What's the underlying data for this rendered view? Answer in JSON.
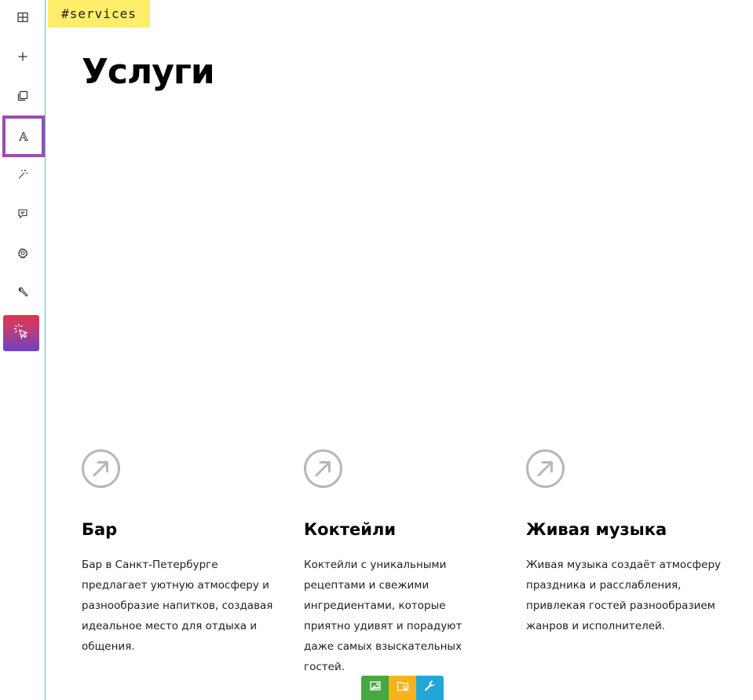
{
  "toolbar": {
    "items": [
      {
        "icon": "layout-grid-icon",
        "name": "blocks"
      },
      {
        "icon": "plus-icon",
        "name": "add"
      },
      {
        "icon": "copy-icon",
        "name": "duplicate"
      },
      {
        "icon": "font-icon",
        "name": "typography",
        "glyph": "𝔸",
        "active": true
      },
      {
        "icon": "magic-wand-icon",
        "name": "effects"
      },
      {
        "icon": "comment-icon",
        "name": "comments"
      },
      {
        "icon": "gear-icon",
        "name": "settings"
      },
      {
        "icon": "wrench-icon",
        "name": "tools"
      },
      {
        "icon": "cursor-click-icon",
        "name": "interactive"
      }
    ],
    "accent_color": "#9b4bb5",
    "border_color": "#33d1bc"
  },
  "anchor_tag": "#services",
  "section": {
    "title": "Услуги"
  },
  "services": [
    {
      "icon": "arrow-up-right-circle-icon",
      "name": "Бар",
      "description": "Бар в Санкт-Петербурге предлагает уютную атмосферу и разнообразие напитков, создавая идеальное место для отдыха и общения."
    },
    {
      "icon": "arrow-up-right-circle-icon",
      "name": "Коктейли",
      "description": "Коктейли с уникальными рецептами и свежими ингредиентами, которые приятно удивят и порадуют даже самых взыскательных гостей."
    },
    {
      "icon": "arrow-up-right-circle-icon",
      "name": "Живая музыка",
      "description": "Живая музыка создаёт атмосферу праздника и расслабления, привлекая гостей разнообразием жанров и исполнителей."
    }
  ],
  "bottom_tools": [
    {
      "icon": "image-icon",
      "color": "#46a842"
    },
    {
      "icon": "folder-search-icon",
      "color": "#f7b21e"
    },
    {
      "icon": "wrench-icon",
      "color": "#22a7d6"
    }
  ]
}
